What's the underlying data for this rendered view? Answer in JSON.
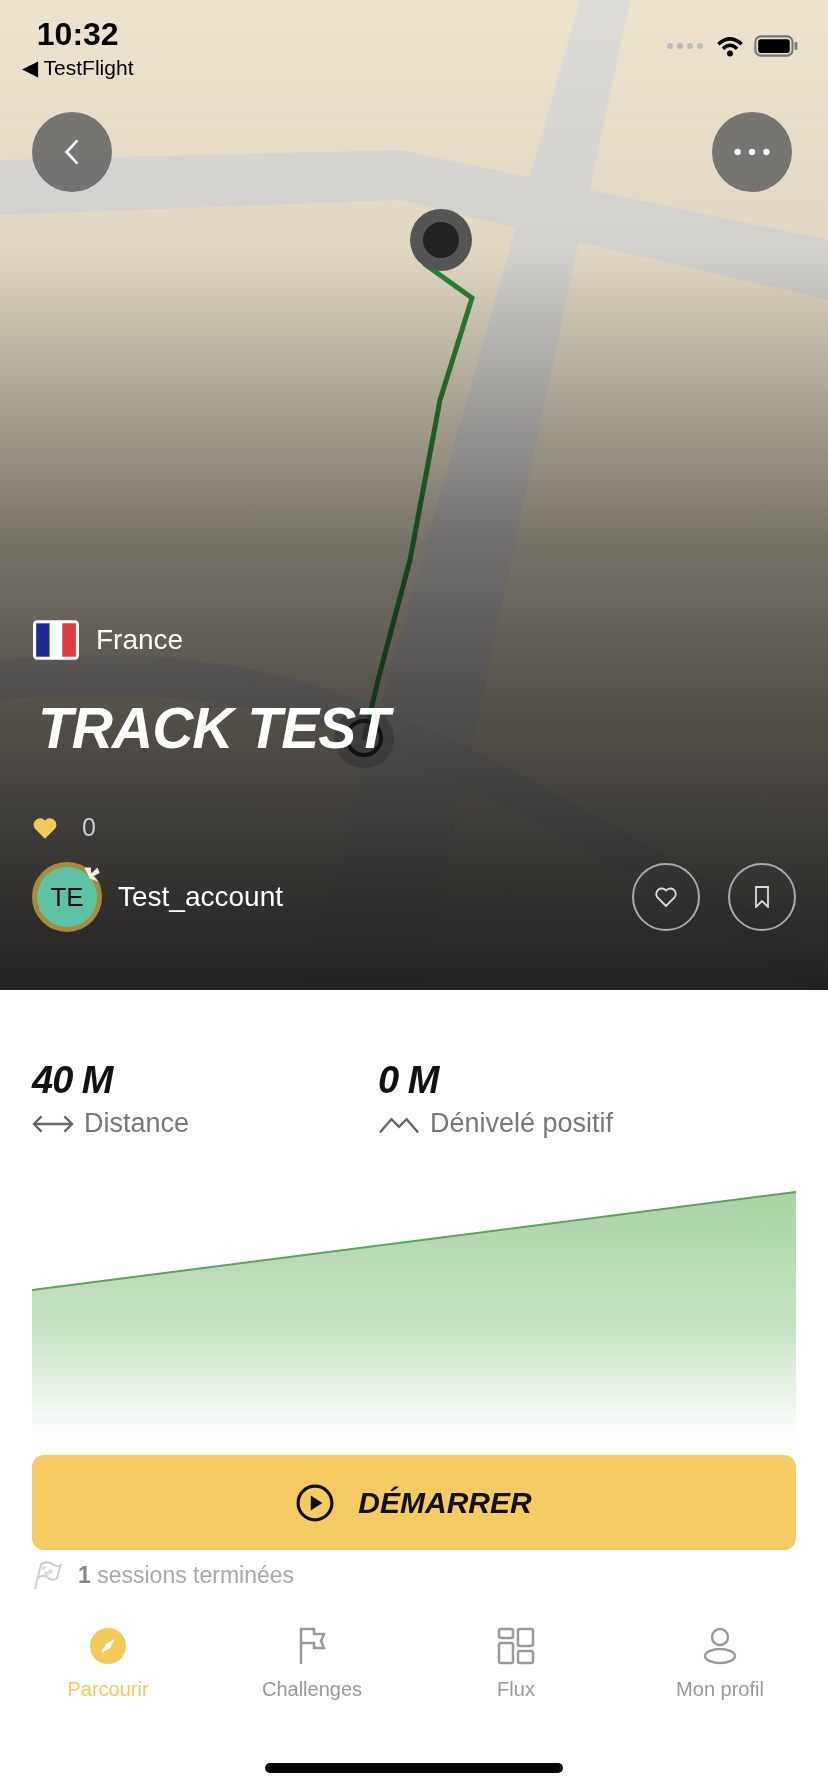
{
  "status_bar": {
    "time": "10:32",
    "back_glyph": "◀",
    "back_app": "TestFlight"
  },
  "track": {
    "country": "France",
    "title": "TRACK TEST",
    "likes": "0",
    "liked": false,
    "bookmarked": false,
    "author": {
      "initials": "TE",
      "name": "Test_account"
    }
  },
  "stats": [
    {
      "kind": "distance",
      "value": "40 M",
      "label": "Distance"
    },
    {
      "kind": "elevation",
      "value": "0 M",
      "label": "Dénivelé positif"
    }
  ],
  "start_button": {
    "label": "DÉMARRER"
  },
  "sessions": "**1** sessions terminées",
  "tab_bar": [
    {
      "kind": "compass",
      "label": "Parcourir",
      "selected": true
    },
    {
      "kind": "flag",
      "label": "Challenges",
      "selected": false
    },
    {
      "kind": "grid",
      "label": "Flux",
      "selected": false
    },
    {
      "kind": "person",
      "label": "Mon profil",
      "selected": false
    }
  ]
}
